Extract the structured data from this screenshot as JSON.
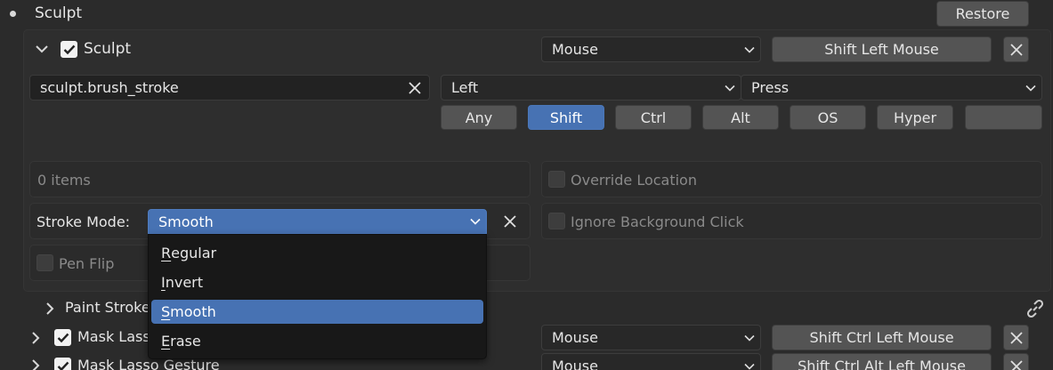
{
  "section": {
    "title": "Sculpt",
    "restore_label": "Restore"
  },
  "keymap_item": {
    "name": "Sculpt",
    "enabled": true,
    "input_type": "Mouse",
    "key_label": "Shift Left Mouse",
    "operator": "sculpt.brush_stroke",
    "event_value": "Left",
    "event_action": "Press",
    "modifiers": [
      {
        "label": "Any",
        "active": false
      },
      {
        "label": "Shift",
        "active": true
      },
      {
        "label": "Ctrl",
        "active": false
      },
      {
        "label": "Alt",
        "active": false
      },
      {
        "label": "OS",
        "active": false
      },
      {
        "label": "Hyper",
        "active": false
      },
      {
        "label": "",
        "active": false
      }
    ]
  },
  "properties": {
    "items_count": "0 items",
    "override_location": "Override Location",
    "stroke_mode_label": "Stroke Mode:",
    "stroke_mode_value": "Smooth",
    "ignore_background_click": "Ignore Background Click",
    "pen_flip": "Pen Flip"
  },
  "dropdown": {
    "options": [
      {
        "first": "R",
        "rest": "egular",
        "selected": false
      },
      {
        "first": "I",
        "rest": "nvert",
        "selected": false
      },
      {
        "first": "S",
        "rest": "mooth",
        "selected": true
      },
      {
        "first": "E",
        "rest": "rase",
        "selected": false
      }
    ]
  },
  "rows": [
    {
      "name": "Paint Stroke",
      "label_visible": "Paint Stroke"
    },
    {
      "name": "Mask Lasso",
      "input_type": "Mouse",
      "key_label": "Shift Ctrl Left Mouse"
    },
    {
      "name": "Mask Lasso Gesture",
      "input_type": "Mouse",
      "key_label": "Shift Ctrl Alt Left Mouse"
    }
  ],
  "colors": {
    "accent": "#4772b3",
    "background": "#2b2b2b",
    "menu_bg": "#181818"
  },
  "icons": [
    "bullet-icon",
    "chevron-down-icon",
    "checkbox-icon",
    "close-icon",
    "chevron-right-icon",
    "link-icon"
  ]
}
